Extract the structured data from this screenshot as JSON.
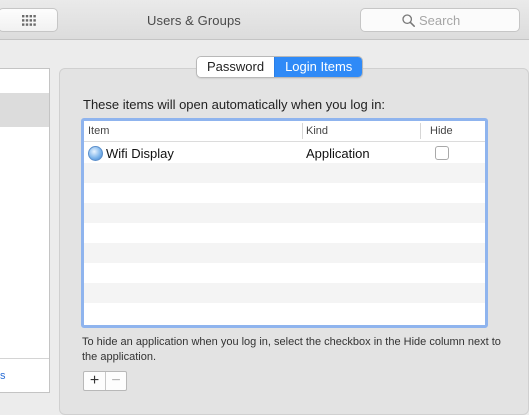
{
  "window": {
    "title": "Users & Groups",
    "show_all_icon": "grid-icon"
  },
  "search": {
    "placeholder": "Search",
    "value": "",
    "icon": "magnifier-icon"
  },
  "tabs": [
    {
      "label": "Password",
      "selected": false
    },
    {
      "label": "Login Items",
      "selected": true
    }
  ],
  "login_items": {
    "intro": "These items will open automatically when you log in:",
    "columns": {
      "item": "Item",
      "kind": "Kind",
      "hide": "Hide"
    },
    "rows": [
      {
        "icon": "globe-app-icon",
        "name": "Wifi Display",
        "kind": "Application",
        "hide": false
      }
    ],
    "help": "To hide an application when you log in, select the checkbox in the Hide column next to the application.",
    "add_label": "+",
    "remove_label": "−"
  },
  "colors": {
    "accent": "#2f8af7",
    "focus_ring": "#8fb4ee"
  }
}
